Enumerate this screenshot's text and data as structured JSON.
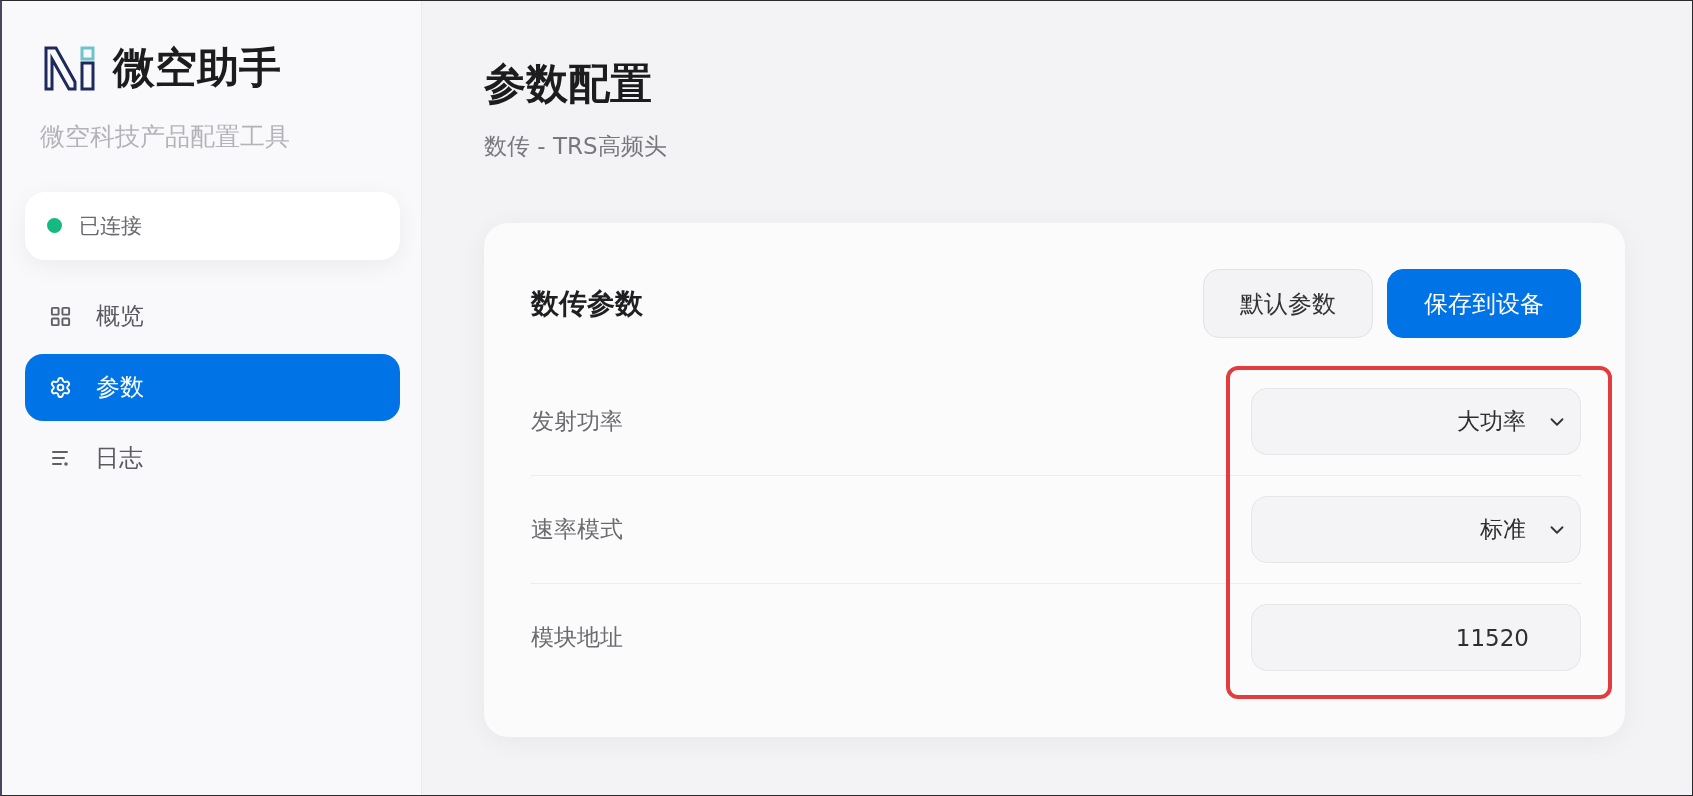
{
  "sidebar": {
    "app_name": "微空助手",
    "subtitle": "微空科技产品配置工具",
    "connection": {
      "label": "已连接",
      "connected": true
    },
    "nav": [
      {
        "label": "概览",
        "kind": "grid",
        "selected": false
      },
      {
        "label": "参数",
        "kind": "gear",
        "selected": true
      },
      {
        "label": "日志",
        "kind": "list",
        "selected": false
      }
    ]
  },
  "main": {
    "title": "参数配置",
    "subtitle": "数传 - TRS高频头",
    "card": {
      "title": "数传参数",
      "buttons": [
        {
          "label": "默认参数",
          "kind": "secondary"
        },
        {
          "label": "保存到设备",
          "kind": "primary"
        }
      ],
      "highlighted": true,
      "params": [
        {
          "label": "发射功率",
          "kind": "select",
          "value": "大功率"
        },
        {
          "label": "速率模式",
          "kind": "select",
          "value": "标准"
        },
        {
          "label": "模块地址",
          "kind": "input",
          "value": "11520"
        }
      ]
    }
  }
}
